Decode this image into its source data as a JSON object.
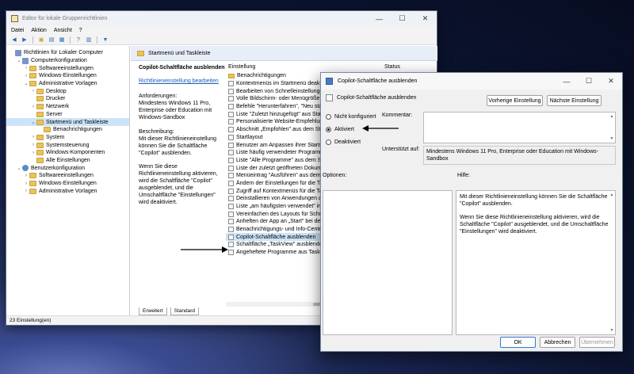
{
  "main": {
    "title": "Editor für lokale Gruppenrichtlinien",
    "menu": [
      "Datei",
      "Aktion",
      "Ansicht",
      "?"
    ],
    "tree": [
      {
        "label": "Richtlinien für Lokaler Computer",
        "level": 0,
        "kind": "pc",
        "chev": ""
      },
      {
        "label": "Computerkonfiguration",
        "level": 1,
        "kind": "pc",
        "chev": "⌄"
      },
      {
        "label": "Softwareeinstellungen",
        "level": 2,
        "kind": "folder",
        "chev": "›"
      },
      {
        "label": "Windows-Einstellungen",
        "level": 2,
        "kind": "folder",
        "chev": "›"
      },
      {
        "label": "Administrative Vorlagen",
        "level": 2,
        "kind": "folder",
        "chev": "⌄"
      },
      {
        "label": "Desktop",
        "level": 3,
        "kind": "folder",
        "chev": "›"
      },
      {
        "label": "Drucker",
        "level": 3,
        "kind": "folder",
        "chev": ""
      },
      {
        "label": "Netzwerk",
        "level": 3,
        "kind": "folder",
        "chev": "›"
      },
      {
        "label": "Server",
        "level": 3,
        "kind": "folder",
        "chev": ""
      },
      {
        "label": "Startmenü und Taskleiste",
        "level": 3,
        "kind": "folder",
        "chev": "⌄",
        "selected": true
      },
      {
        "label": "Benachrichtigungen",
        "level": 4,
        "kind": "folder",
        "chev": ""
      },
      {
        "label": "System",
        "level": 3,
        "kind": "folder",
        "chev": "›"
      },
      {
        "label": "Systemsteuerung",
        "level": 3,
        "kind": "folder",
        "chev": "›"
      },
      {
        "label": "Windows-Komponenten",
        "level": 3,
        "kind": "folder",
        "chev": "›"
      },
      {
        "label": "Alle Einstellungen",
        "level": 3,
        "kind": "folder",
        "chev": ""
      },
      {
        "label": "Benutzerkonfiguration",
        "level": 1,
        "kind": "user",
        "chev": "⌄"
      },
      {
        "label": "Softwareeinstellungen",
        "level": 2,
        "kind": "folder",
        "chev": "›"
      },
      {
        "label": "Windows-Einstellungen",
        "level": 2,
        "kind": "folder",
        "chev": "›"
      },
      {
        "label": "Administrative Vorlagen",
        "level": 2,
        "kind": "folder",
        "chev": "›"
      }
    ],
    "pane_header": "Startmenü und Taskleiste",
    "desc": {
      "heading": "Copilot-Schaltfläche ausblenden",
      "link": "Richtlinieneinstellung bearbeiten",
      "req": "Anforderungen:\nMindestens Windows 11 Pro, Enterprise oder Education mit Windows-Sandbox",
      "desc": "Beschreibung:\nMit dieser Richtlinieneinstellung können Sie die Schaltfläche \"Copilot\" ausblenden.",
      "desc2": "Wenn Sie diese Richtlinieneinstellung aktivieren, wird die Schaltfläche \"Copilot\" ausgeblendet, und die Umschaltfläche \"Einstellungen\" wird deaktiviert."
    },
    "list_cols": [
      "Einstellung",
      "Status"
    ],
    "list": [
      {
        "label": "Benachrichtigungen",
        "folder": true
      },
      {
        "label": "Kontextmenüs im Startmenü deaktivi"
      },
      {
        "label": "Bearbeiten von Schnelleinstellungen a"
      },
      {
        "label": "Volle Bildschirm- oder Menügröße für"
      },
      {
        "label": "Befehle \"Herunterfahren\", \"Neu starte"
      },
      {
        "label": "Liste \"Zuletzt hinzugefügt\" aus Startm"
      },
      {
        "label": "Personalisierte Website-Empfehlunge"
      },
      {
        "label": "Abschnitt „Empfohlen\" aus dem Start"
      },
      {
        "label": "Startlayout"
      },
      {
        "label": "Benutzer am Anpassen ihrer Startseite"
      },
      {
        "label": "Liste häufig verwendeter Programme"
      },
      {
        "label": "Liste \"Alle Programme\" aus dem Start"
      },
      {
        "label": "Liste der zuletzt geöffneten Dokument"
      },
      {
        "label": "Menüeintrag \"Ausführen\" aus dem Sta"
      },
      {
        "label": "Ändern der Einstellungen für die Task"
      },
      {
        "label": "Zugriff auf Kontextmenüs für die Task"
      },
      {
        "label": "Deinstallieren von Anwendungen aus"
      },
      {
        "label": "Liste „am häufigsten verwendet\" im St"
      },
      {
        "label": "Vereinfachen des Layouts für Schnelle"
      },
      {
        "label": "Anheften der App an „Start\" bei der In"
      },
      {
        "label": "Benachrichtigungs- und Info-Center e"
      },
      {
        "label": "Copilot-Schaltfläche ausblenden",
        "selected": true
      },
      {
        "label": "Schaltfläche „TaskView\" ausblenden"
      },
      {
        "label": "Angeheftete Programme aus Taskleist"
      }
    ],
    "tabs": [
      "Erweitert",
      "Standard"
    ],
    "status": "23 Einstellung(en)"
  },
  "dialog": {
    "title": "Copilot-Schaltfläche ausblenden",
    "policy_name": "Copilot-Schaltfläche ausblenden",
    "prev_btn": "Vorherige Einstellung",
    "next_btn": "Nächste Einstellung",
    "radios": [
      {
        "label": "Nicht konfiguriert",
        "checked": false
      },
      {
        "label": "Aktiviert",
        "checked": true
      },
      {
        "label": "Deaktiviert",
        "checked": false
      }
    ],
    "comment_label": "Kommentar:",
    "supported_label": "Unterstützt auf:",
    "supported_value": "Mindestens Windows 11 Pro, Enterprise oder Education mit Windows-Sandbox",
    "options_label": "Optionen:",
    "help_label": "Hilfe:",
    "help_p1": "Mit dieser Richtlinieneinstellung können Sie die Schaltfläche \"Copilot\" ausblenden.",
    "help_p2": "Wenn Sie diese Richtlinieneinstellung aktivieren, wird die Schaltfläche \"Copilot\" ausgeblendet, und die Umschaltfläche \"Einstellungen\" wird deaktiviert.",
    "ok": "OK",
    "cancel": "Abbrechen",
    "apply": "Übernehmen"
  }
}
